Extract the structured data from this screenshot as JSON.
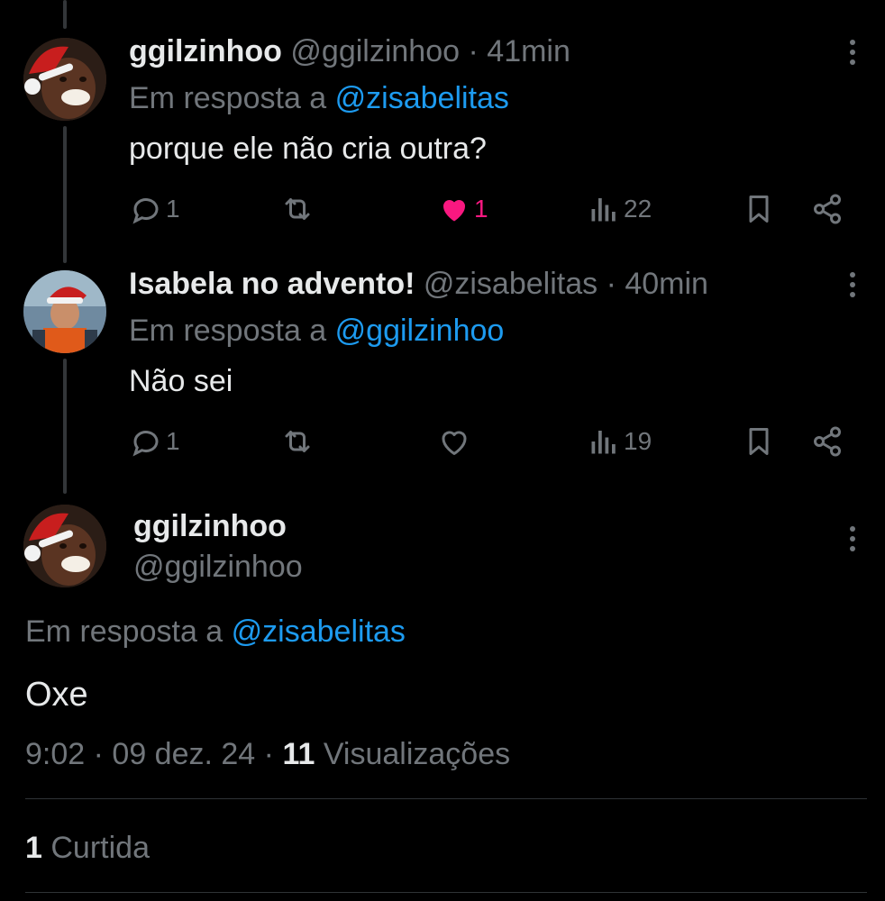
{
  "colors": {
    "background": "#000000",
    "text": "#e7e9ea",
    "muted": "#71767b",
    "link": "#1d9bf0",
    "like": "#f91880",
    "divider": "#2f3336"
  },
  "tweets": [
    {
      "name": "ggilzinhoo",
      "handle": "@ggilzinhoo",
      "sep": "·",
      "time": "41min",
      "reply_prefix": "Em resposta a",
      "reply_to": "@zisabelitas",
      "text": "porque ele não cria outra?",
      "replies": "1",
      "retweets": "",
      "likes": "1",
      "liked": true,
      "views": "22"
    },
    {
      "name": "Isabela no advento!",
      "handle": "@zisabelitas",
      "sep": "·",
      "time": "40min",
      "reply_prefix": "Em resposta a",
      "reply_to": "@ggilzinhoo",
      "text": "Não sei",
      "replies": "1",
      "retweets": "",
      "likes": "",
      "liked": false,
      "views": "19"
    }
  ],
  "main_tweet": {
    "name": "ggilzinhoo",
    "handle": "@ggilzinhoo",
    "reply_prefix": "Em resposta a",
    "reply_to": "@zisabelitas",
    "text": "Oxe",
    "time": "9:02",
    "date": "09 dez. 24",
    "sep": "·",
    "views_count": "11",
    "views_label": "Visualizações",
    "likes_count": "1",
    "likes_label": "Curtida"
  },
  "icons": {
    "reply": "reply-icon",
    "retweet": "retweet-icon",
    "like": "heart-icon",
    "views": "views-icon",
    "bookmark": "bookmark-icon",
    "share": "share-icon",
    "more": "more-options-icon"
  }
}
